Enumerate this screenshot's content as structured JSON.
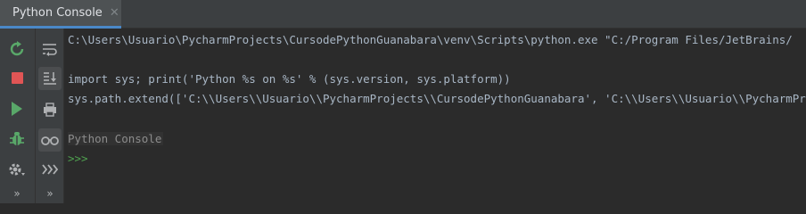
{
  "tab": {
    "title": "Python Console",
    "close_glyph": "✕"
  },
  "left_toolbar": [
    {
      "name": "rerun-icon",
      "color": "#59a869"
    },
    {
      "name": "stop-icon",
      "color": "#e05555"
    },
    {
      "name": "run-icon",
      "color": "#59a869"
    },
    {
      "name": "debug-icon",
      "color": "#59a869"
    },
    {
      "name": "settings-icon",
      "color": "#afb1b3"
    },
    {
      "name": "more-icon",
      "color": "#afb1b3"
    }
  ],
  "right_toolbar": [
    {
      "name": "soft-wrap-icon"
    },
    {
      "name": "scroll-to-end-icon"
    },
    {
      "name": "print-icon"
    },
    {
      "name": "show-variables-icon"
    },
    {
      "name": "execute-history-icon"
    },
    {
      "name": "more-icon"
    }
  ],
  "console": {
    "lines": [
      "C:\\Users\\Usuario\\PycharmProjects\\CursodePythonGuanabara\\venv\\Scripts\\python.exe \"C:/Program Files/JetBrains/",
      "",
      "import sys; print('Python %s on %s' % (sys.version, sys.platform))",
      "sys.path.extend(['C:\\\\Users\\\\Usuario\\\\PycharmProjects\\\\CursodePythonGuanabara', 'C:\\\\Users\\\\Usuario\\\\PycharmProjects",
      "",
      "Python Console",
      ">>>"
    ],
    "prompt": ">>>",
    "banner": "Python Console"
  },
  "colors": {
    "background": "#2b2b2b",
    "text": "#a9b7c6",
    "prompt": "#4fa14f",
    "tab_underline": "#4a88c7"
  }
}
